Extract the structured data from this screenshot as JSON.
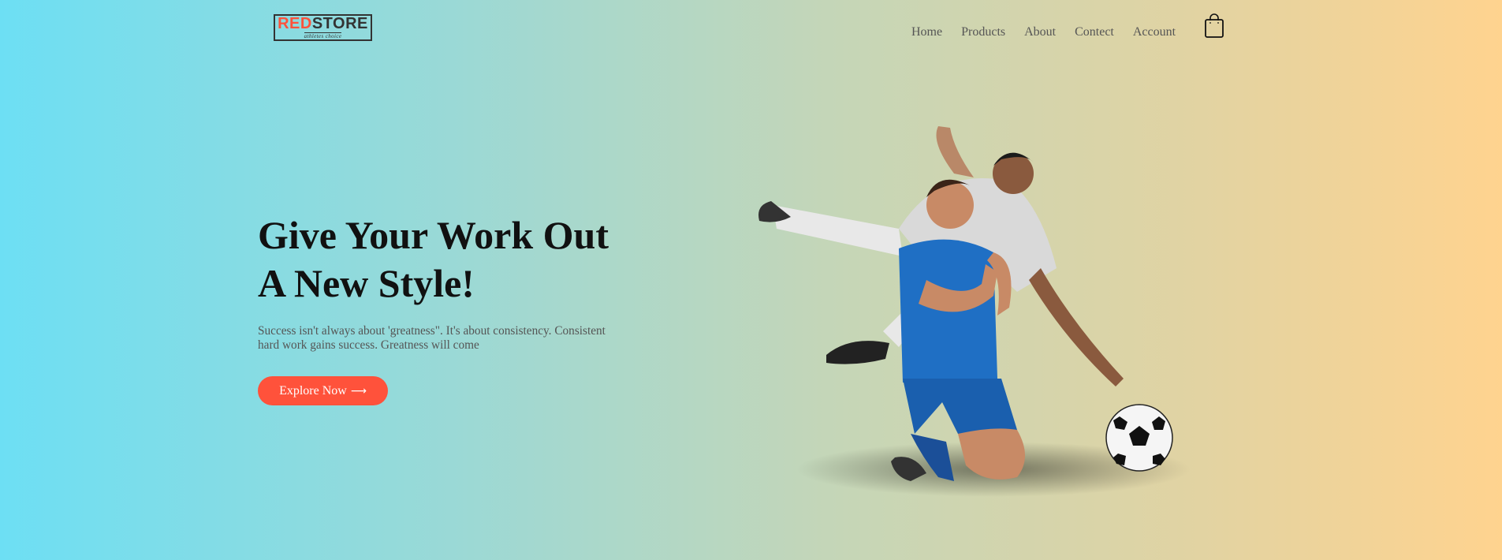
{
  "brand": {
    "logo_part1": "RED",
    "logo_part2": "STORE",
    "tagline": "athletes choice",
    "accent_color": "#ff523b"
  },
  "nav": {
    "items": [
      {
        "label": "Home"
      },
      {
        "label": "Products"
      },
      {
        "label": "About"
      },
      {
        "label": "Contect"
      },
      {
        "label": "Account"
      }
    ],
    "cart_icon": "shopping-bag-icon"
  },
  "hero": {
    "title_line1": "Give Your Work Out",
    "title_line2": "A New Style!",
    "description": "Success isn't always about 'greatness\". It's about consistency. Consistent hard work gains success. Greatness will come",
    "cta_label": "Explore Now",
    "cta_arrow": "⟶",
    "image_icon": "soccer-players-illustration"
  }
}
